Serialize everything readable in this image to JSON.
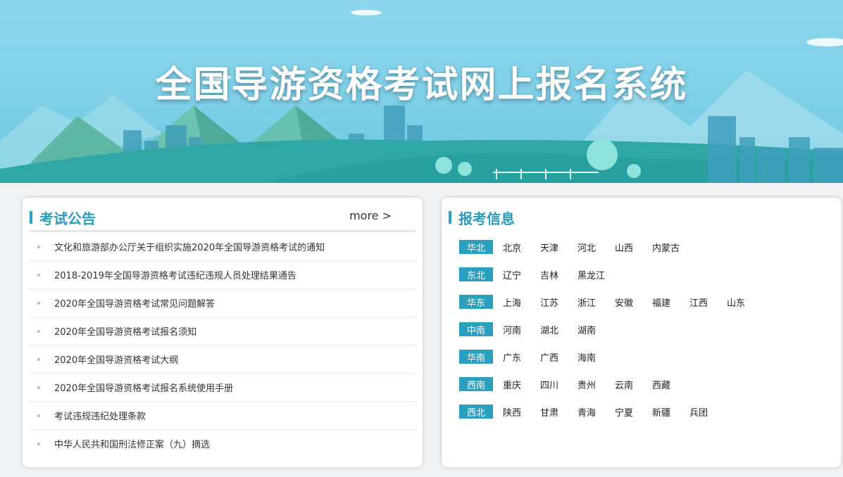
{
  "banner": {
    "title": "全国导游资格考试网上报名系统"
  },
  "notices": {
    "title": "考试公告",
    "more": "more >",
    "items": [
      "文化和旅游部办公厅关于组织实施2020年全国导游资格考试的通知",
      "2018-2019年全国导游资格考试违纪违规人员处理结果通告",
      "2020年全国导游资格考试常见问题解答",
      "2020年全国导游资格考试报名须知",
      "2020年全国导游资格考试大纲",
      "2020年全国导游资格考试报名系统使用手册",
      "考试违规违纪处理条款",
      "中华人民共和国刑法修正案（九）摘选"
    ]
  },
  "registration": {
    "title": "报考信息",
    "regions": [
      {
        "name": "华北",
        "provinces": [
          "北京",
          "天津",
          "河北",
          "山西",
          "内蒙古"
        ]
      },
      {
        "name": "东北",
        "provinces": [
          "辽宁",
          "吉林",
          "黑龙江"
        ]
      },
      {
        "name": "华东",
        "provinces": [
          "上海",
          "江苏",
          "浙江",
          "安徽",
          "福建",
          "江西",
          "山东"
        ]
      },
      {
        "name": "中南",
        "provinces": [
          "河南",
          "湖北",
          "湖南"
        ]
      },
      {
        "name": "华南",
        "provinces": [
          "广东",
          "广西",
          "海南"
        ]
      },
      {
        "name": "西南",
        "provinces": [
          "重庆",
          "四川",
          "贵州",
          "云南",
          "西藏"
        ]
      },
      {
        "name": "西北",
        "provinces": [
          "陕西",
          "甘肃",
          "青海",
          "宁夏",
          "新疆",
          "兵团"
        ]
      }
    ]
  },
  "colors": {
    "accent": "#2a9fbe",
    "banner_sky": "#8bd6ec"
  }
}
